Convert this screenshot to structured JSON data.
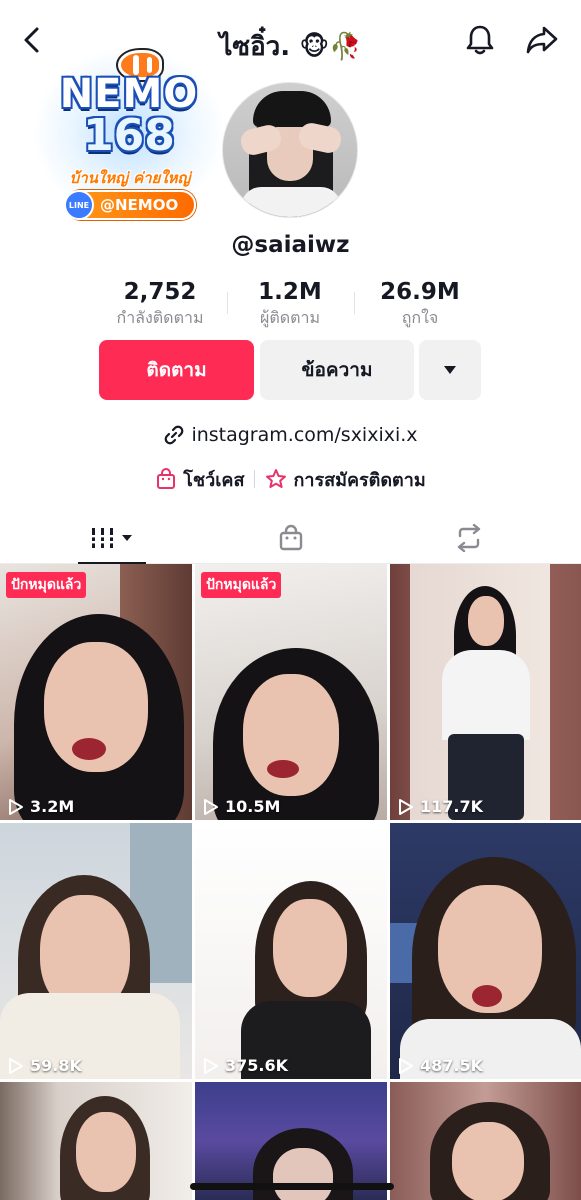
{
  "header": {
    "title": "ไซอิ๋ว. 🐵🥀"
  },
  "ad": {
    "brand": "NEMO",
    "number": "168",
    "slogan": "บ้านใหญ่ ค่ายใหญ่",
    "line_badge": "LINE",
    "handle": "@NEMOO",
    "colors": {
      "blue": "#1b4fb8",
      "orange": "#ff7a00"
    }
  },
  "profile": {
    "username": "@saiaiwz",
    "stats": [
      {
        "value": "2,752",
        "label": "กำลังติดตาม"
      },
      {
        "value": "1.2M",
        "label": "ผู้ติดตาม"
      },
      {
        "value": "26.9M",
        "label": "ถูกใจ"
      }
    ],
    "follow_label": "ติดตาม",
    "message_label": "ข้อความ",
    "link": "instagram.com/sxixixi.x",
    "showcase_label": "โชว์เคส",
    "subscribe_label": "การสมัครติดตาม"
  },
  "tabs": [
    {
      "icon": "video-grid-icon",
      "active": true
    },
    {
      "icon": "shopping-bag-icon",
      "active": false
    },
    {
      "icon": "repost-icon",
      "active": false
    }
  ],
  "videos": [
    {
      "views": "3.2M",
      "pinned": true
    },
    {
      "views": "10.5M",
      "pinned": true
    },
    {
      "views": "117.7K",
      "pinned": false
    },
    {
      "views": "59.8K",
      "pinned": false
    },
    {
      "views": "375.6K",
      "pinned": false
    },
    {
      "views": "487.5K",
      "pinned": false
    },
    {
      "views": "",
      "pinned": false
    },
    {
      "views": "",
      "pinned": false
    },
    {
      "views": "",
      "pinned": false
    }
  ],
  "pinned_label": "ปักหมุดแล้ว",
  "colors": {
    "accent": "#fe2c55",
    "text": "#161823",
    "muted": "#8a8b91"
  }
}
